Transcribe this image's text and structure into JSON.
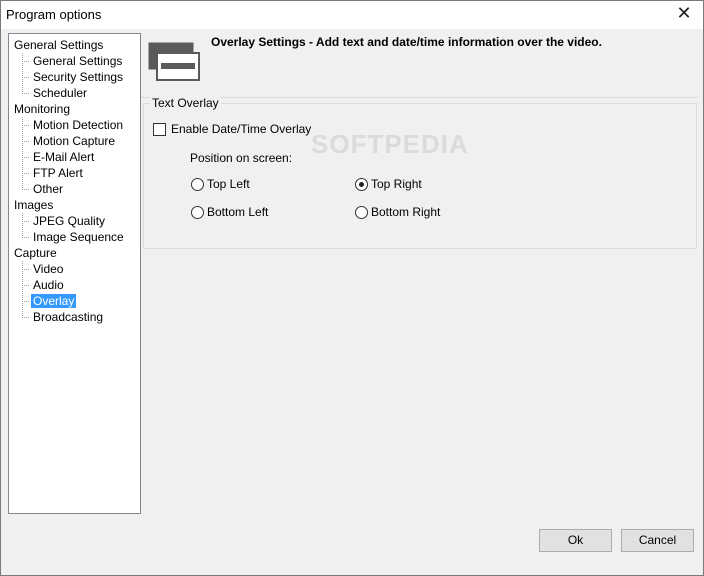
{
  "window": {
    "title": "Program options",
    "close_glyph": "✕"
  },
  "tree": {
    "groups": [
      {
        "label": "General Settings",
        "children": [
          "General Settings",
          "Security Settings",
          "Scheduler"
        ]
      },
      {
        "label": "Monitoring",
        "children": [
          "Motion Detection",
          "Motion Capture",
          "E-Mail Alert",
          "FTP Alert",
          "Other"
        ]
      },
      {
        "label": "Images",
        "children": [
          "JPEG Quality",
          "Image Sequence"
        ]
      },
      {
        "label": "Capture",
        "children": [
          "Video",
          "Audio",
          "Overlay",
          "Broadcasting"
        ]
      }
    ],
    "selected": "Overlay"
  },
  "header": {
    "text": "Overlay Settings - Add text and date/time information over the video."
  },
  "text_overlay": {
    "group_title": "Text Overlay",
    "enable_label": "Enable Date/Time Overlay",
    "enable_checked": false,
    "position_label": "Position on screen:",
    "positions": {
      "top_left": "Top Left",
      "top_right": "Top Right",
      "bottom_left": "Bottom Left",
      "bottom_right": "Bottom Right"
    },
    "selected_position": "Top Right"
  },
  "watermark": "SOFTPEDIA",
  "buttons": {
    "ok": "Ok",
    "cancel": "Cancel"
  },
  "colors": {
    "selection": "#3399ff",
    "window_bg": "#f0f0f0"
  }
}
